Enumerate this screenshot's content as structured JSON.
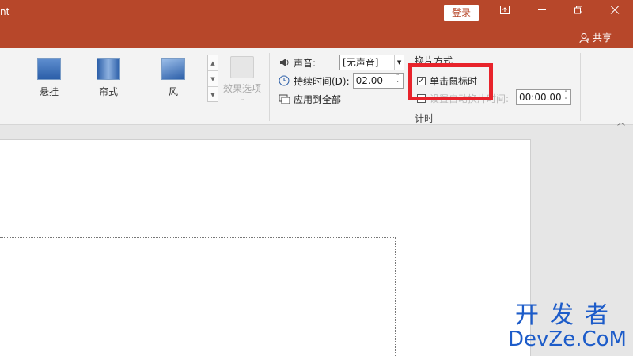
{
  "titlebar": {
    "app_title_fragment": "nt",
    "login_label": "登录",
    "share_label": "共享"
  },
  "gallery": {
    "items": [
      {
        "label": "悬挂"
      },
      {
        "label": "帘式"
      },
      {
        "label": "风"
      }
    ]
  },
  "effect_options": {
    "label": "效果选项"
  },
  "timing": {
    "sound_label": "声音:",
    "sound_value": "[无声音]",
    "duration_label": "持续时间(D):",
    "duration_value": "02.00",
    "apply_all_label": "应用到全部",
    "advance_heading": "换片方式",
    "on_click_label": "单击鼠标时",
    "on_click_checked": true,
    "after_label": "设置自动换片时间:",
    "after_value": "00:00.00",
    "group_label": "计时"
  },
  "watermark": {
    "cn": "开发者",
    "en": "DevZe.CoM"
  },
  "colors": {
    "accent": "#b7472a",
    "highlight": "#e8232b",
    "watermark": "#1d5cc9"
  }
}
